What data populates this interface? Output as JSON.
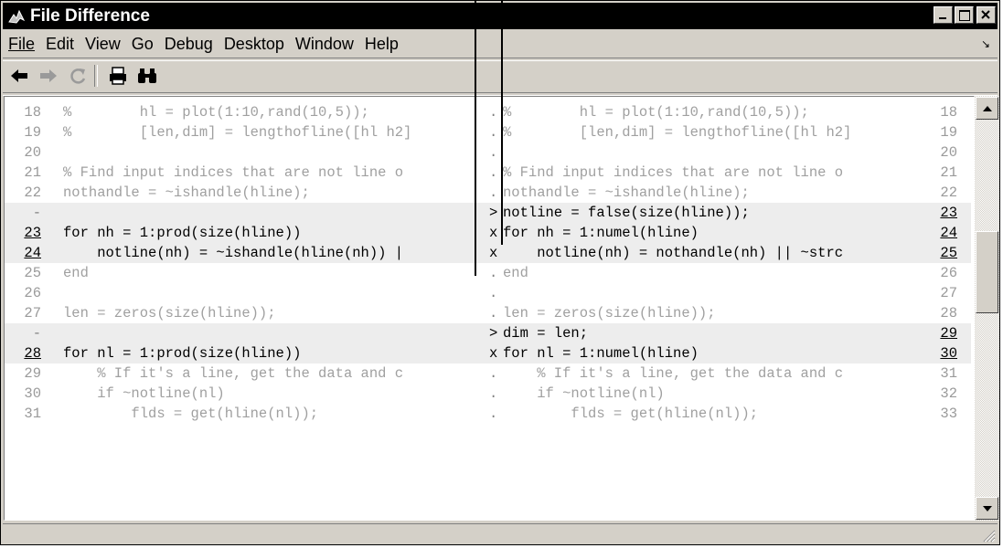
{
  "window": {
    "title": "File Difference",
    "icon": "matlab-icon",
    "controls": [
      "minimize-icon",
      "maximize-icon",
      "close-icon"
    ]
  },
  "menu": [
    {
      "label": "File"
    },
    {
      "label": "Edit"
    },
    {
      "label": "View"
    },
    {
      "label": "Go"
    },
    {
      "label": "Debug"
    },
    {
      "label": "Desktop"
    },
    {
      "label": "Window"
    },
    {
      "label": "Help"
    }
  ],
  "toolbar": [
    "back-arrow-icon",
    "forward-arrow-icon",
    "refresh-icon",
    "print-icon",
    "find-binoculars-icon"
  ],
  "diff_rows": [
    {
      "ln": "18",
      "left": "%        hl = plot(1:10,rand(10,5));",
      "mark": ".",
      "right": "%        hl = plot(1:10,rand(10,5));",
      "rn": "18",
      "changed": false
    },
    {
      "ln": "19",
      "left": "%        [len,dim] = lengthofline([hl h2]",
      "mark": ".",
      "right": "%        [len,dim] = lengthofline([hl h2]",
      "rn": "19",
      "changed": false
    },
    {
      "ln": "20",
      "left": "",
      "mark": ".",
      "right": "",
      "rn": "20",
      "changed": false
    },
    {
      "ln": "21",
      "left": "% Find input indices that are not line o",
      "mark": ".",
      "right": "% Find input indices that are not line o",
      "rn": "21",
      "changed": false
    },
    {
      "ln": "22",
      "left": "nothandle = ~ishandle(hline);",
      "mark": ".",
      "right": "nothandle = ~ishandle(hline);",
      "rn": "22",
      "changed": false
    },
    {
      "ln": "-",
      "left": "",
      "mark": ">",
      "right": "notline = false(size(hline));",
      "rn": "23",
      "changed": true
    },
    {
      "ln": "23",
      "left": "for nh = 1:prod(size(hline))",
      "mark": "x",
      "right": "for nh = 1:numel(hline)",
      "rn": "24",
      "changed": true
    },
    {
      "ln": "24",
      "left": "    notline(nh) = ~ishandle(hline(nh)) |",
      "mark": "x",
      "right": "    notline(nh) = nothandle(nh) || ~strc",
      "rn": "25",
      "changed": true
    },
    {
      "ln": "25",
      "left": "end",
      "mark": ".",
      "right": "end",
      "rn": "26",
      "changed": false
    },
    {
      "ln": "26",
      "left": "",
      "mark": ".",
      "right": "",
      "rn": "27",
      "changed": false
    },
    {
      "ln": "27",
      "left": "len = zeros(size(hline));",
      "mark": ".",
      "right": "len = zeros(size(hline));",
      "rn": "28",
      "changed": false
    },
    {
      "ln": "-",
      "left": "",
      "mark": ">",
      "right": "dim = len;",
      "rn": "29",
      "changed": true
    },
    {
      "ln": "28",
      "left": "for nl = 1:prod(size(hline))",
      "mark": "x",
      "right": "for nl = 1:numel(hline)",
      "rn": "30",
      "changed": true
    },
    {
      "ln": "29",
      "left": "    % If it's a line, get the data and c",
      "mark": ".",
      "right": "    % If it's a line, get the data and c",
      "rn": "31",
      "changed": false
    },
    {
      "ln": "30",
      "left": "    if ~notline(nl)",
      "mark": ".",
      "right": "    if ~notline(nl)",
      "rn": "32",
      "changed": false
    },
    {
      "ln": "31",
      "left": "        flds = get(hline(nl));",
      "mark": ".",
      "right": "        flds = get(hline(nl));",
      "rn": "33",
      "changed": false
    }
  ],
  "scrollbar": [
    "scroll-up-icon",
    "scroll-down-icon"
  ],
  "status_text": ""
}
